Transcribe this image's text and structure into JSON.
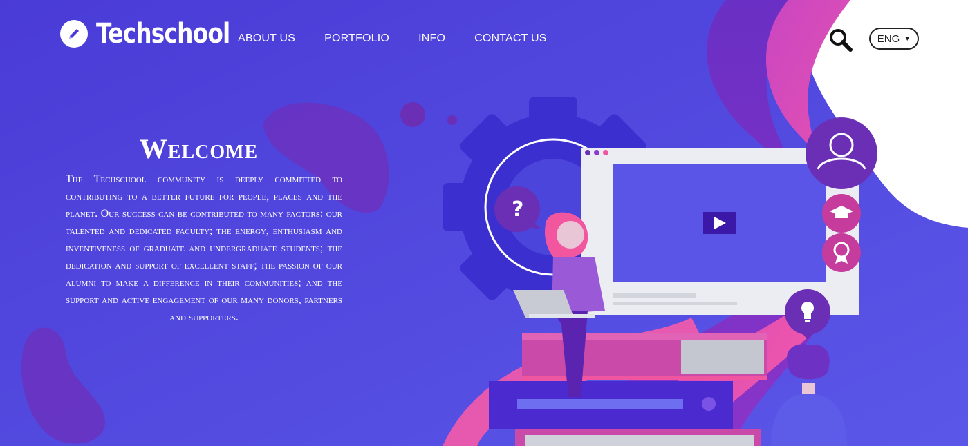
{
  "brand": {
    "name": "Techschool",
    "icon": "pencil-icon"
  },
  "nav": {
    "items": [
      "ABOUT US",
      "PORTFOLIO",
      "INFO",
      "CONTACT US"
    ]
  },
  "header": {
    "search_icon": "search-icon",
    "language": "ENG",
    "language_caret": "▼"
  },
  "hero": {
    "title": "Welcome",
    "body": "The Techschool community is deeply committed to contributing to a better future for people, places and the planet.  Our success can be contributed to many factors:  our talented and dedicated faculty; the energy, enthusiasm and inventiveness of graduate and undergraduate students; the dedication and support of excellent staff; the passion of our alumni to make a difference in  their communities; and the support and active engagement of our many donors, partners and supporters."
  },
  "illustration": {
    "question_mark": "?",
    "icons": [
      "gear-icon",
      "user-icon",
      "graduation-cap-icon",
      "award-icon",
      "lightbulb-icon",
      "play-icon"
    ]
  },
  "colors": {
    "background": "#5448dc",
    "accent_pink": "#f0569f",
    "accent_purple": "#6b2fb5",
    "gear_blue": "#3b32d0"
  }
}
